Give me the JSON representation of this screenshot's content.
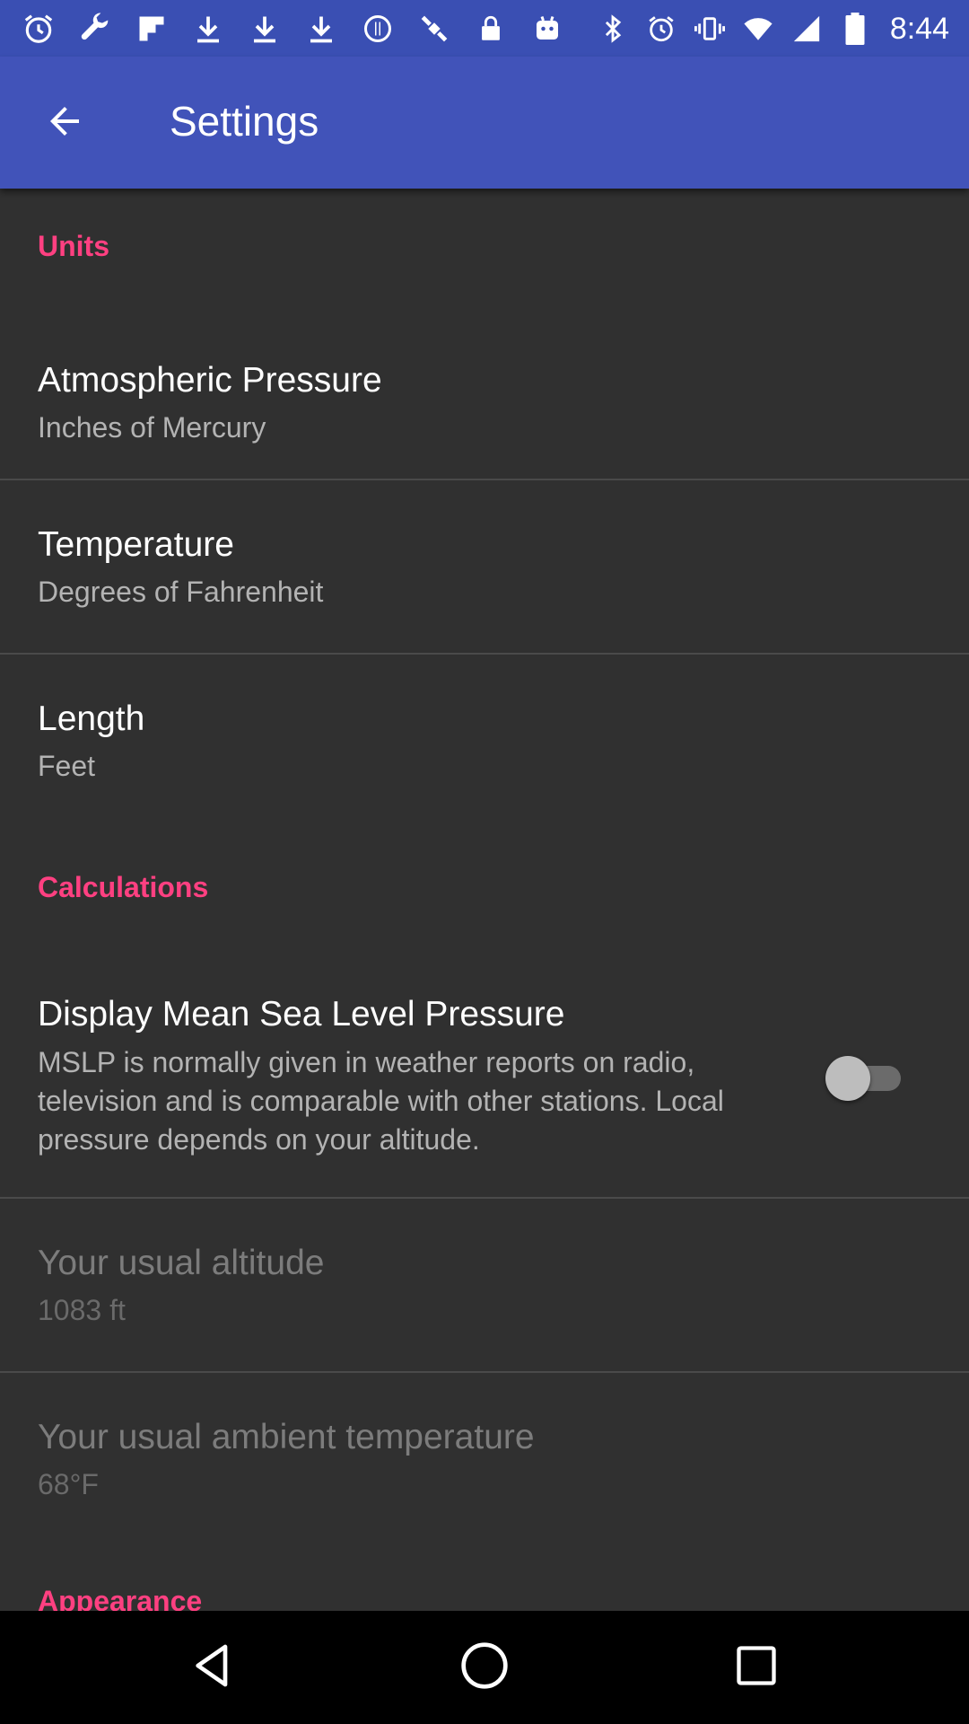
{
  "status_bar": {
    "left_icons": [
      "alarm-icon",
      "wrench-icon",
      "flipboard-icon",
      "download-icon",
      "download-icon",
      "download-icon",
      "signal-circle-icon",
      "satellite-icon",
      "lock-icon",
      "robot-icon"
    ],
    "right_icons": [
      "bluetooth-icon",
      "alarm-icon",
      "vibrate-icon",
      "wifi-icon",
      "cell-signal-icon",
      "battery-icon"
    ],
    "time": "8:44"
  },
  "app_bar": {
    "title": "Settings",
    "back_icon": "arrow-back-icon",
    "color": "#4153b9"
  },
  "sections": {
    "units": {
      "header": "Units",
      "atmospheric_pressure": {
        "title": "Atmospheric Pressure",
        "summary": "Inches of Mercury"
      },
      "temperature": {
        "title": "Temperature",
        "summary": "Degrees of Fahrenheit"
      },
      "length": {
        "title": "Length",
        "summary": "Feet"
      }
    },
    "calculations": {
      "header": "Calculations",
      "mslp": {
        "title": "Display Mean Sea Level Pressure",
        "summary": "MSLP is normally given in weather reports on radio, television and is comparable with other stations. Local pressure depends on your altitude.",
        "enabled": false
      },
      "altitude": {
        "title": "Your usual altitude",
        "summary": "1083 ft"
      },
      "ambient_temperature": {
        "title": "Your usual ambient temperature",
        "summary": "68°F"
      }
    },
    "appearance": {
      "header": "Appearance"
    }
  },
  "colors": {
    "accent": "#ff4081",
    "background": "#303030",
    "status_bar": "#3a4fb3"
  },
  "nav_bar": {
    "icons": [
      "back-triangle-icon",
      "home-circle-icon",
      "recents-square-icon"
    ]
  }
}
